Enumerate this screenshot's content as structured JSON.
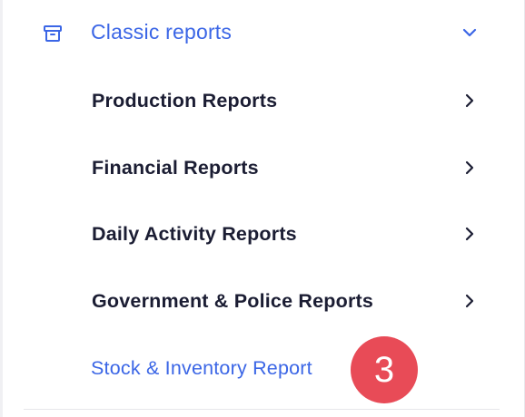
{
  "section": {
    "title": "Classic reports",
    "icon": "archive-icon",
    "expanded": true,
    "toggle_icon": "chevron-down-icon"
  },
  "items": [
    {
      "label": "Production Reports",
      "icon": "chevron-right-icon"
    },
    {
      "label": "Financial Reports",
      "icon": "chevron-right-icon"
    },
    {
      "label": "Daily Activity Reports",
      "icon": "chevron-right-icon"
    },
    {
      "label": "Government & Police Reports",
      "icon": "chevron-right-icon"
    }
  ],
  "active_item": {
    "label": "Stock & Inventory Report"
  },
  "badge": {
    "value": "3",
    "color": "#e84b57"
  },
  "colors": {
    "accent": "#3b66e6",
    "text": "#1b1d33"
  }
}
